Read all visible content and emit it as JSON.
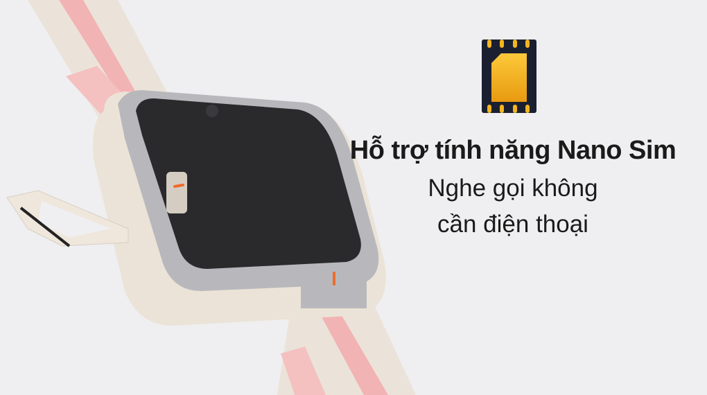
{
  "headline": "Hỗ trợ tính năng Nano Sim",
  "sub_lines": [
    "Nghe gọi không",
    "cần điện thoại"
  ],
  "icon": "nano-sim-card-icon",
  "colors": {
    "background": "#efeff1",
    "sim_gold": "#f2b01e",
    "sim_frame": "#1b2030",
    "strap_pink": "#f2a9ad",
    "watch_body": "#ece4da"
  }
}
